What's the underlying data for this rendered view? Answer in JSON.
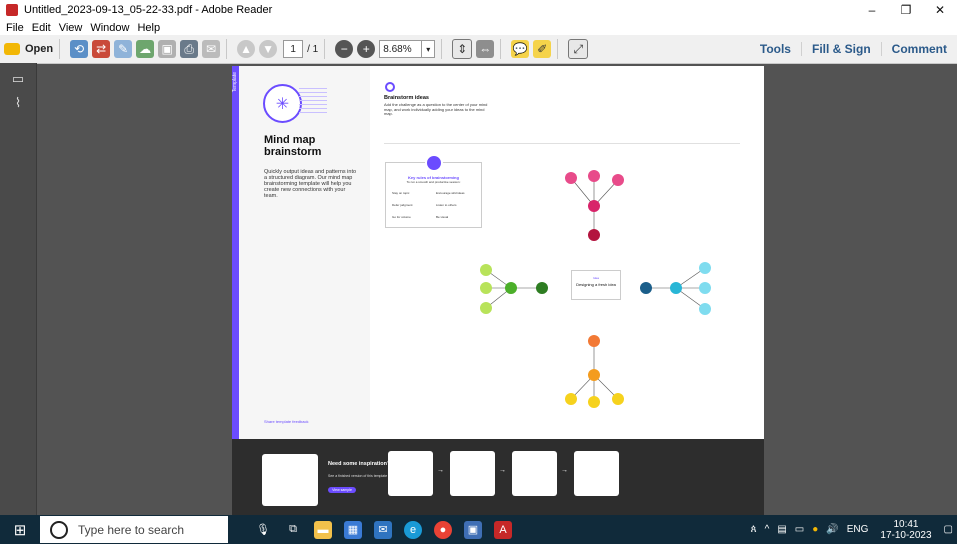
{
  "window": {
    "title": "Untitled_2023-09-13_05-22-33.pdf - Adobe Reader",
    "controls": [
      "–",
      "❐",
      "✕"
    ]
  },
  "menu": [
    "File",
    "Edit",
    "View",
    "Window",
    "Help"
  ],
  "toolbar": {
    "open_label": "Open",
    "page_current": "1",
    "page_total": "/ 1",
    "zoom": "8.68%",
    "right_links": [
      "Tools",
      "Fill & Sign",
      "Comment"
    ]
  },
  "document": {
    "left": {
      "tag": "Template",
      "title_line1": "Mind map",
      "title_line2": "brainstorm",
      "body": "Quickly output ideas and patterns into a structured diagram. Our mind map brainstorming template will help you create new connections with your team.",
      "share": "Share template feedback"
    },
    "right": {
      "heading": "Brainstorm ideas",
      "body": "Add the challenge as a question to the center of your mind map, and work individually adding your ideas to the mind map.",
      "rules_title": "Key rules of brainstorming",
      "rules_sub": "To run a smooth and productive session:",
      "rules": [
        "Stay on topic",
        "Encourage wild ideas",
        "Defer judgment",
        "Listen to others",
        "Go for volume",
        "Be visual"
      ],
      "center_label": "Idea",
      "center_text": "Designing a fresh idea"
    },
    "footer": {
      "inspired_title": "Need some inspiration?",
      "inspired_text": "See a finished version of this template to kickstart your work.",
      "cta": "View sample"
    }
  },
  "taskbar": {
    "search_placeholder": "Type here to search",
    "tray_lang": "ENG",
    "time": "10:41",
    "date": "17-10-2023"
  }
}
